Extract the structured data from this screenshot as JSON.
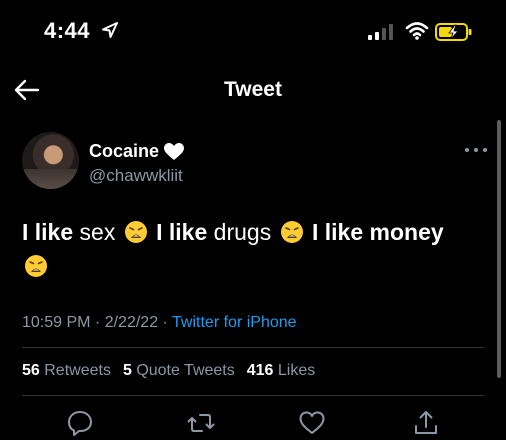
{
  "status": {
    "time": "4:44"
  },
  "nav": {
    "title": "Tweet"
  },
  "author": {
    "name": "Cocaine",
    "handle": "@chawwkliit"
  },
  "tweet": {
    "parts": [
      "I like",
      " sex ",
      "I like",
      " drugs ",
      "I like money"
    ]
  },
  "meta": {
    "time": "10:59 PM",
    "sep1": " · ",
    "date": "2/22/22",
    "sep2": " · ",
    "source": "Twitter for iPhone"
  },
  "stats": {
    "retweets_count": "56",
    "retweets_label": "Retweets",
    "quotes_count": "5",
    "quotes_label": "Quote Tweets",
    "likes_count": "416",
    "likes_label": "Likes"
  },
  "icons": {
    "location": "location-arrow-icon",
    "signal": "cell-signal-icon",
    "wifi": "wifi-icon",
    "battery": "battery-charging-icon",
    "back": "arrow-left-icon",
    "heart": "white-heart-icon",
    "more": "more-dots-icon",
    "emoji": "weary-face-emoji",
    "reply": "reply-icon",
    "retweet": "retweet-icon",
    "like": "like-heart-icon",
    "share": "share-icon"
  },
  "colors": {
    "background": "#000000",
    "text": "#ffffff",
    "secondary": "#8b98a5",
    "link": "#1d9bf0",
    "battery": "#f5d90a"
  }
}
